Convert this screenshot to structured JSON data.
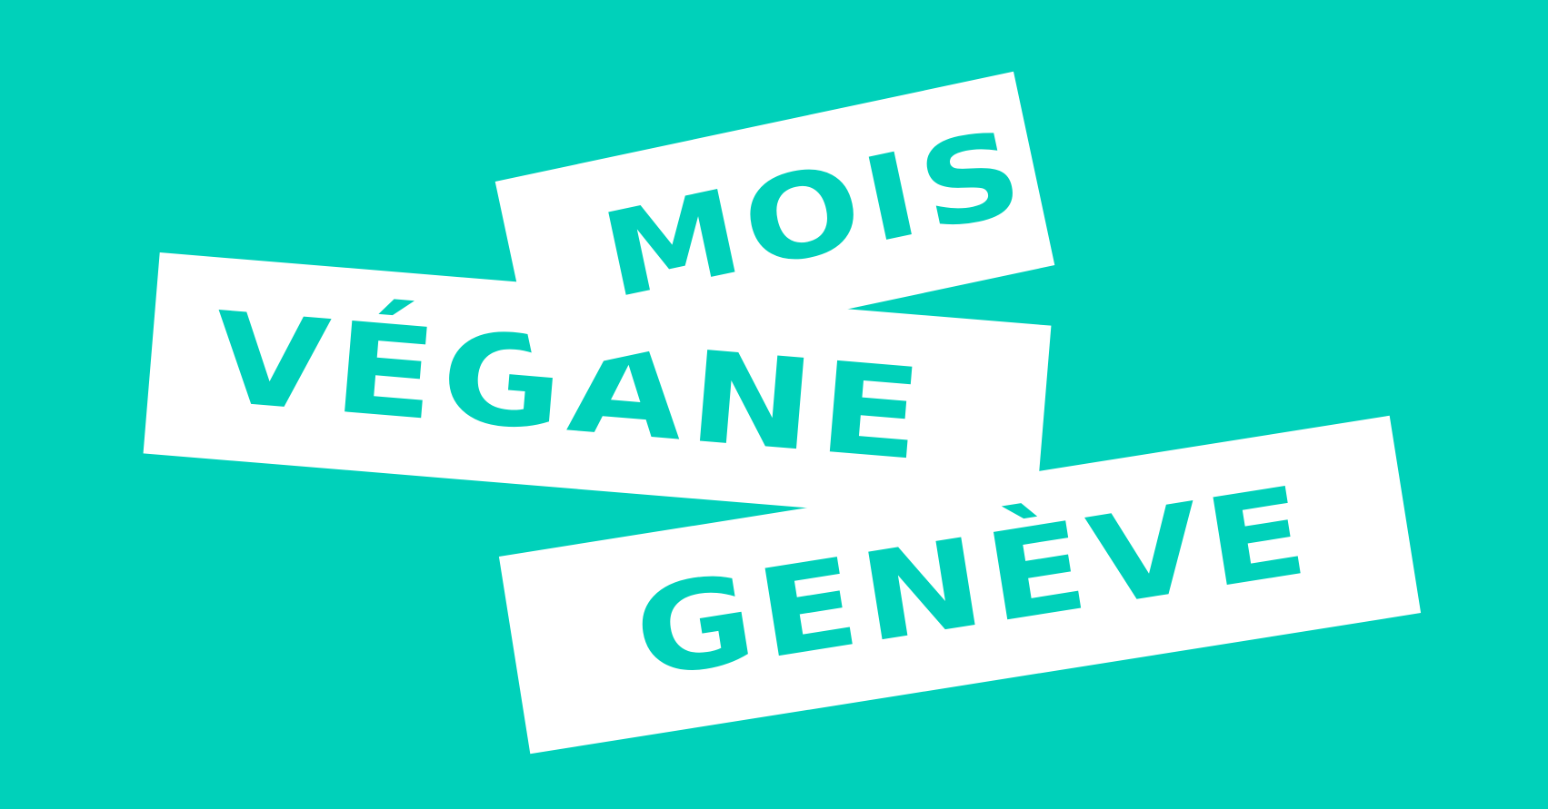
{
  "colors": {
    "background": "#00D1BA",
    "banner": "#FFFFFF",
    "text": "#00D1BA"
  },
  "banners": {
    "line1": "MOIS",
    "line2": "VÉGANE",
    "line3": "GENÈVE"
  }
}
